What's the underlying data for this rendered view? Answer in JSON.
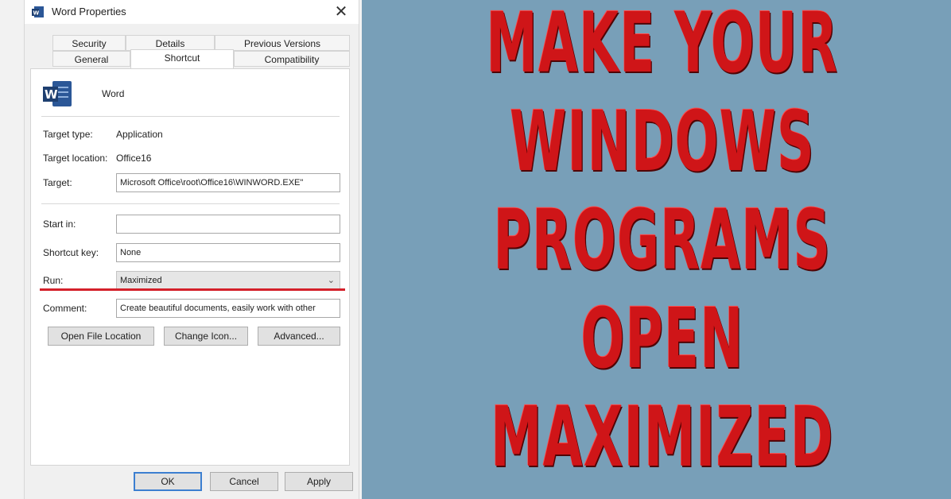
{
  "dialog": {
    "title": "Word Properties",
    "close_glyph": "✕",
    "tabs_row1": [
      "Security",
      "Details",
      "Previous Versions"
    ],
    "tabs_row2": [
      "General",
      "Shortcut",
      "Compatibility"
    ],
    "active_tab": "Shortcut",
    "app_name": "Word",
    "fields": {
      "target_type_label": "Target type:",
      "target_type_value": "Application",
      "target_location_label": "Target location:",
      "target_location_value": "Office16",
      "target_label": "Target:",
      "target_value": "Microsoft Office\\root\\Office16\\WINWORD.EXE\"",
      "start_in_label": "Start in:",
      "start_in_value": "",
      "shortcut_key_label": "Shortcut key:",
      "shortcut_key_value": "None",
      "run_label": "Run:",
      "run_value": "Maximized",
      "comment_label": "Comment:",
      "comment_value": "Create beautiful documents, easily work with other"
    },
    "buttons": {
      "open_file_location": "Open File Location",
      "change_icon": "Change Icon...",
      "advanced": "Advanced...",
      "ok": "OK",
      "cancel": "Cancel",
      "apply": "Apply"
    }
  },
  "headline": {
    "lines": [
      "MAKE YOUR",
      "WINDOWS",
      "PROGRAMS",
      "OPEN",
      "MAXIMIZED"
    ]
  },
  "colors": {
    "background_right": "#789fb8",
    "headline_red": "#cf1518",
    "highlight_red": "#d4202a",
    "word_blue": "#2b5797"
  },
  "icons": [
    "word-app-icon",
    "close-icon",
    "chevron-down-icon"
  ]
}
